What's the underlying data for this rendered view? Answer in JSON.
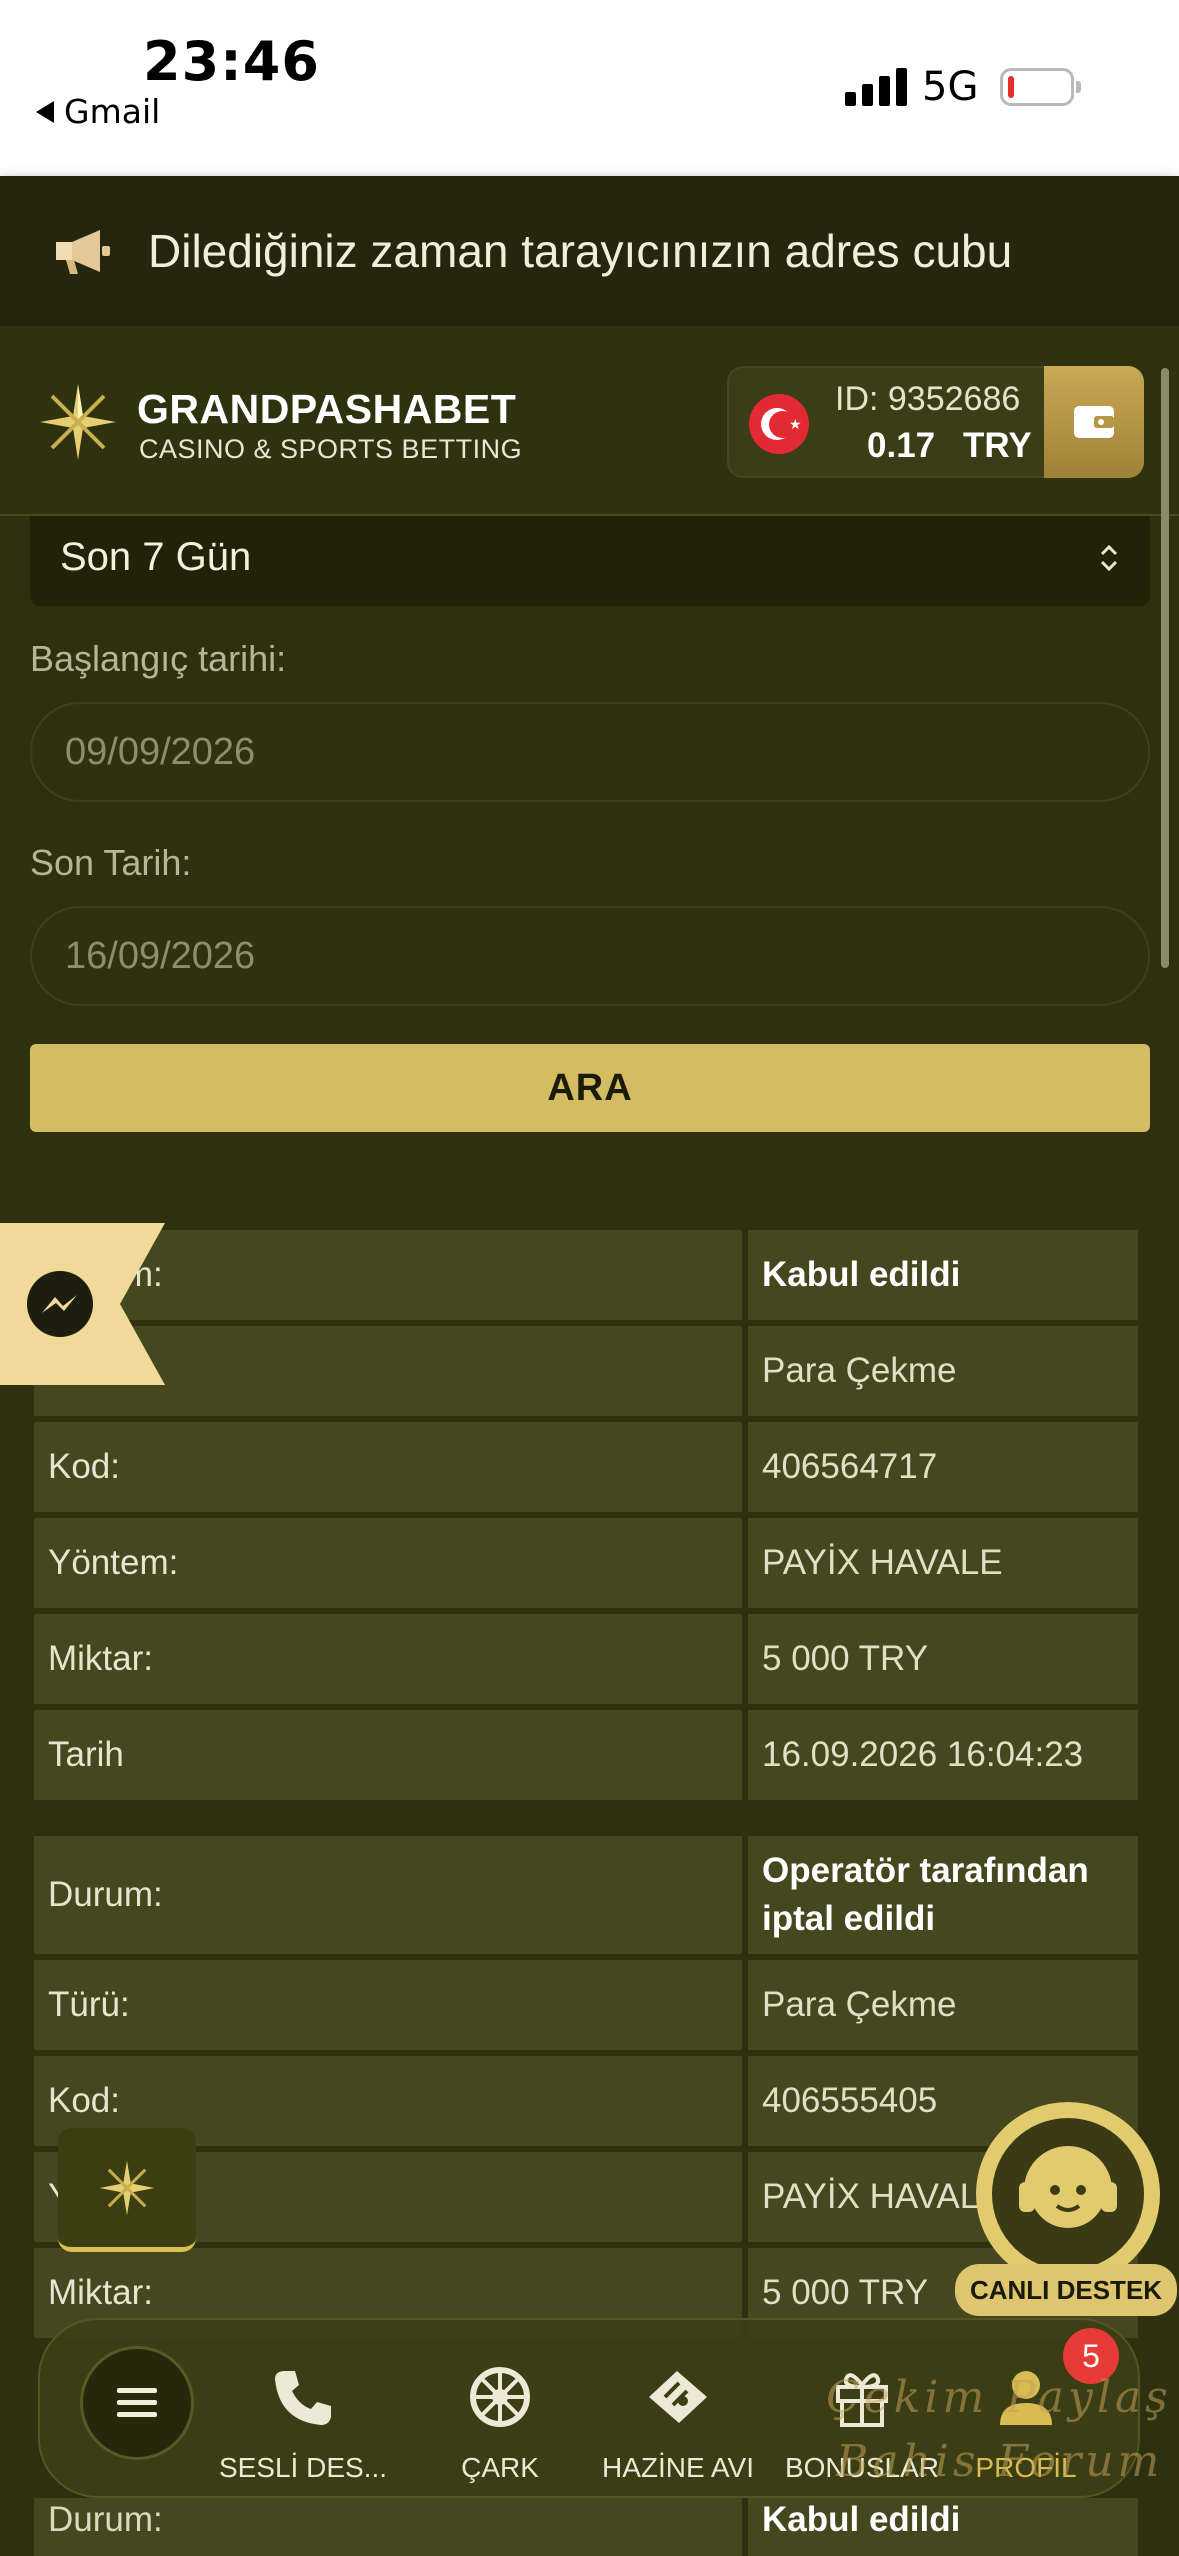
{
  "status_bar": {
    "time": "23:46",
    "back_app": "Gmail",
    "network": "5G"
  },
  "announcement": {
    "text": "Dilediğiniz zaman tarayıcınızın adres cubu"
  },
  "header": {
    "brand_name": "GRANDPASHABET",
    "brand_sub": "CASINO & SPORTS BETTING",
    "account_id": "ID: 9352686",
    "balance": "0.17",
    "currency": "TRY"
  },
  "filters": {
    "period": "Son 7 Gün",
    "start_label": "Başlangıç tarihi:",
    "start_value": "09/09/2026",
    "end_label": "Son Tarih:",
    "end_value": "16/09/2026",
    "search_label": "ARA"
  },
  "records": [
    {
      "rows": [
        {
          "key": "Durum:",
          "value": "Kabul edildi"
        },
        {
          "key": "Türü:",
          "value": "Para Çekme"
        },
        {
          "key": "Kod:",
          "value": "406564717"
        },
        {
          "key": "Yöntem:",
          "value": "PAYİX HAVALE"
        },
        {
          "key": "Miktar:",
          "value": "5 000 TRY"
        },
        {
          "key": "Tarih",
          "value": "16.09.2026 16:04:23"
        }
      ]
    },
    {
      "rows": [
        {
          "key": "Durum:",
          "value": "Operatör tarafından iptal edildi"
        },
        {
          "key": "Türü:",
          "value": "Para Çekme"
        },
        {
          "key": "Kod:",
          "value": "406555405"
        },
        {
          "key": "Yöntem:",
          "value": "PAYİX HAVALE"
        },
        {
          "key": "Miktar:",
          "value": "5 000 TRY"
        }
      ]
    }
  ],
  "partial_record": {
    "key": "Durum:",
    "value": "Kabul edildi"
  },
  "support": {
    "label": "CANLI DESTEK"
  },
  "bottom_nav": {
    "items": [
      {
        "label": "SESLİ DES...",
        "icon": "phone-icon"
      },
      {
        "label": "ÇARK",
        "icon": "wheel-icon"
      },
      {
        "label": "HAZİNE AVI",
        "icon": "treasure-ticket-icon"
      },
      {
        "label": "BONUSLAR",
        "icon": "gift-icon"
      },
      {
        "label": "PROFİL",
        "icon": "profile-icon"
      }
    ],
    "profile_badge": "5"
  },
  "watermark": {
    "line1": "Çekim Paylaş",
    "line2": "Bahis Forum"
  },
  "colors": {
    "accent_gold": "#d3bc62",
    "background": "#2e3110",
    "row_bg": "#45481e",
    "badge_red": "#e73b38"
  }
}
